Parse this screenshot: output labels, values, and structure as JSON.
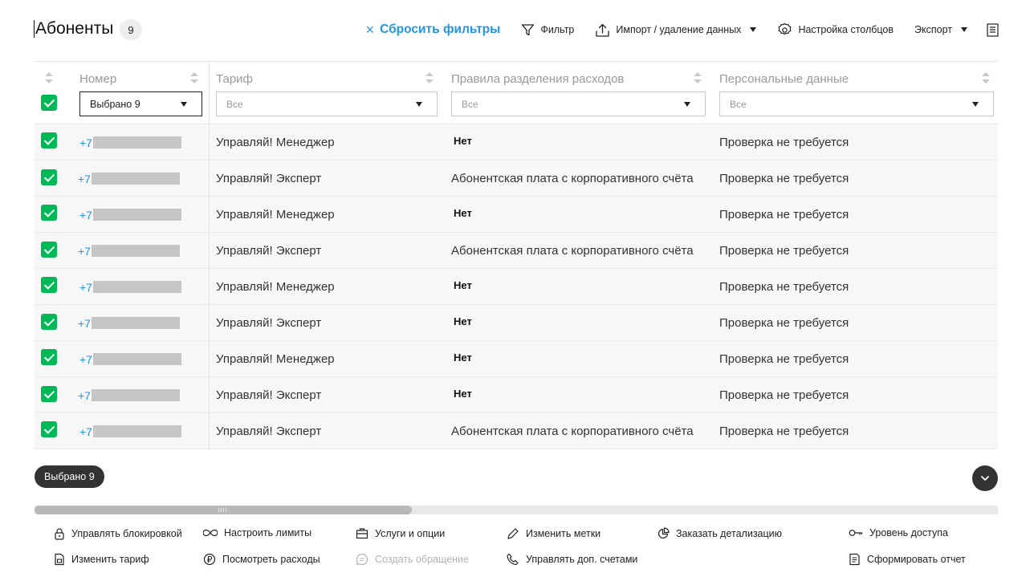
{
  "header": {
    "title": "Абоненты",
    "count": "9",
    "reset_filters": "Сбросить фильтры",
    "reset_icon": "×",
    "filter": "Фильтр",
    "import": "Импорт / удаление данных",
    "columns_settings": "Настройка столбцов",
    "export": "Экспорт"
  },
  "table": {
    "columns": {
      "number": "Номер",
      "tariff": "Тариф",
      "rules": "Правила разделения расходов",
      "personal": "Персональные данные"
    },
    "filters": {
      "number": "Выбрано 9",
      "tariff": "Все",
      "rules": "Все",
      "personal": "Все"
    },
    "rows": [
      {
        "phone_prefix": "+7",
        "tariff": "Управляй! Менеджер",
        "rules": "Нет",
        "personal": "Проверка не требуется"
      },
      {
        "phone_prefix": "+7",
        "tariff": "Управляй! Эксперт",
        "rules": "Абонентская плата с корпоративного счёта",
        "personal": "Проверка не требуется"
      },
      {
        "phone_prefix": "+7",
        "tariff": "Управляй! Менеджер",
        "rules": "Нет",
        "personal": "Проверка не требуется"
      },
      {
        "phone_prefix": "+7",
        "tariff": "Управляй! Эксперт",
        "rules": "Абонентская плата с корпоративного счёта",
        "personal": "Проверка не требуется"
      },
      {
        "phone_prefix": "+7",
        "tariff": "Управляй! Менеджер",
        "rules": "Нет",
        "personal": "Проверка не требуется"
      },
      {
        "phone_prefix": "+7",
        "tariff": "Управляй! Эксперт",
        "rules": "Нет",
        "personal": "Проверка не требуется"
      },
      {
        "phone_prefix": "+7",
        "tariff": "Управляй! Менеджер",
        "rules": "Нет",
        "personal": "Проверка не требуется"
      },
      {
        "phone_prefix": "+7",
        "tariff": "Управляй! Эксперт",
        "rules": "Нет",
        "personal": "Проверка не требуется"
      },
      {
        "phone_prefix": "+7",
        "tariff": "Управляй! Эксперт",
        "rules": "Абонентская плата с корпоративного счёта",
        "personal": "Проверка не требуется"
      }
    ]
  },
  "selection": {
    "pill": "Выбрано 9"
  },
  "actions": {
    "manage_block": "Управлять блокировкой",
    "set_limits": "Настроить лимиты",
    "services": "Услуги и опции",
    "edit_tags": "Изменить метки",
    "order_details": "Заказать детализацию",
    "access_level": "Уровень доступа",
    "change_tariff": "Изменить тариф",
    "view_expenses": "Посмотреть расходы",
    "create_request": "Создать обращение",
    "manage_accounts": "Управлять доп. счетами",
    "make_report": "Сформировать отчет"
  },
  "colors": {
    "accent": "#2196e6",
    "check": "#00b956",
    "dark": "#333333"
  }
}
